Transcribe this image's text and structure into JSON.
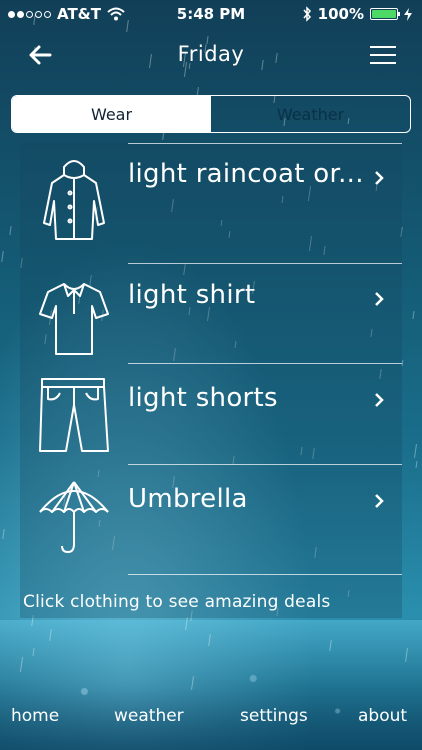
{
  "status_bar": {
    "carrier": "AT&T",
    "time": "5:48 PM",
    "battery_percent": "100%",
    "signal_bars_filled": 2,
    "signal_bars_total": 5,
    "battery_level": 1.0,
    "battery_color": "#4cd964"
  },
  "nav": {
    "title": "Friday",
    "back_icon": "arrow-left-icon",
    "menu_icon": "hamburger-menu-icon"
  },
  "segments": {
    "wear": "Wear",
    "weather": "Weather",
    "selected": "Wear"
  },
  "items": [
    {
      "label": "light raincoat or...",
      "icon": "raincoat-icon"
    },
    {
      "label": "light shirt",
      "icon": "shirt-icon"
    },
    {
      "label": "light shorts",
      "icon": "shorts-icon"
    },
    {
      "label": "Umbrella",
      "icon": "umbrella-icon"
    }
  ],
  "hint": "Click clothing to see amazing deals",
  "tab_bar": {
    "home": "home",
    "weather": "weather",
    "settings": "settings",
    "about": "about"
  }
}
